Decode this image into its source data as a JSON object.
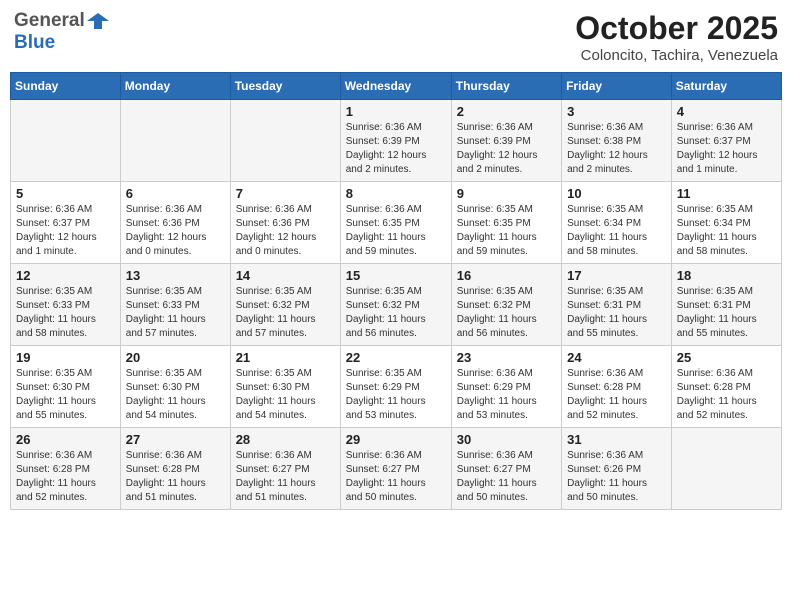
{
  "header": {
    "logo": {
      "general": "General",
      "blue": "Blue",
      "icon": "▶"
    },
    "title": "October 2025",
    "location": "Coloncito, Tachira, Venezuela"
  },
  "calendar": {
    "days_of_week": [
      "Sunday",
      "Monday",
      "Tuesday",
      "Wednesday",
      "Thursday",
      "Friday",
      "Saturday"
    ],
    "weeks": [
      [
        {
          "day": "",
          "info": ""
        },
        {
          "day": "",
          "info": ""
        },
        {
          "day": "",
          "info": ""
        },
        {
          "day": "1",
          "info": "Sunrise: 6:36 AM\nSunset: 6:39 PM\nDaylight: 12 hours\nand 2 minutes."
        },
        {
          "day": "2",
          "info": "Sunrise: 6:36 AM\nSunset: 6:39 PM\nDaylight: 12 hours\nand 2 minutes."
        },
        {
          "day": "3",
          "info": "Sunrise: 6:36 AM\nSunset: 6:38 PM\nDaylight: 12 hours\nand 2 minutes."
        },
        {
          "day": "4",
          "info": "Sunrise: 6:36 AM\nSunset: 6:37 PM\nDaylight: 12 hours\nand 1 minute."
        }
      ],
      [
        {
          "day": "5",
          "info": "Sunrise: 6:36 AM\nSunset: 6:37 PM\nDaylight: 12 hours\nand 1 minute."
        },
        {
          "day": "6",
          "info": "Sunrise: 6:36 AM\nSunset: 6:36 PM\nDaylight: 12 hours\nand 0 minutes."
        },
        {
          "day": "7",
          "info": "Sunrise: 6:36 AM\nSunset: 6:36 PM\nDaylight: 12 hours\nand 0 minutes."
        },
        {
          "day": "8",
          "info": "Sunrise: 6:36 AM\nSunset: 6:35 PM\nDaylight: 11 hours\nand 59 minutes."
        },
        {
          "day": "9",
          "info": "Sunrise: 6:35 AM\nSunset: 6:35 PM\nDaylight: 11 hours\nand 59 minutes."
        },
        {
          "day": "10",
          "info": "Sunrise: 6:35 AM\nSunset: 6:34 PM\nDaylight: 11 hours\nand 58 minutes."
        },
        {
          "day": "11",
          "info": "Sunrise: 6:35 AM\nSunset: 6:34 PM\nDaylight: 11 hours\nand 58 minutes."
        }
      ],
      [
        {
          "day": "12",
          "info": "Sunrise: 6:35 AM\nSunset: 6:33 PM\nDaylight: 11 hours\nand 58 minutes."
        },
        {
          "day": "13",
          "info": "Sunrise: 6:35 AM\nSunset: 6:33 PM\nDaylight: 11 hours\nand 57 minutes."
        },
        {
          "day": "14",
          "info": "Sunrise: 6:35 AM\nSunset: 6:32 PM\nDaylight: 11 hours\nand 57 minutes."
        },
        {
          "day": "15",
          "info": "Sunrise: 6:35 AM\nSunset: 6:32 PM\nDaylight: 11 hours\nand 56 minutes."
        },
        {
          "day": "16",
          "info": "Sunrise: 6:35 AM\nSunset: 6:32 PM\nDaylight: 11 hours\nand 56 minutes."
        },
        {
          "day": "17",
          "info": "Sunrise: 6:35 AM\nSunset: 6:31 PM\nDaylight: 11 hours\nand 55 minutes."
        },
        {
          "day": "18",
          "info": "Sunrise: 6:35 AM\nSunset: 6:31 PM\nDaylight: 11 hours\nand 55 minutes."
        }
      ],
      [
        {
          "day": "19",
          "info": "Sunrise: 6:35 AM\nSunset: 6:30 PM\nDaylight: 11 hours\nand 55 minutes."
        },
        {
          "day": "20",
          "info": "Sunrise: 6:35 AM\nSunset: 6:30 PM\nDaylight: 11 hours\nand 54 minutes."
        },
        {
          "day": "21",
          "info": "Sunrise: 6:35 AM\nSunset: 6:30 PM\nDaylight: 11 hours\nand 54 minutes."
        },
        {
          "day": "22",
          "info": "Sunrise: 6:35 AM\nSunset: 6:29 PM\nDaylight: 11 hours\nand 53 minutes."
        },
        {
          "day": "23",
          "info": "Sunrise: 6:36 AM\nSunset: 6:29 PM\nDaylight: 11 hours\nand 53 minutes."
        },
        {
          "day": "24",
          "info": "Sunrise: 6:36 AM\nSunset: 6:28 PM\nDaylight: 11 hours\nand 52 minutes."
        },
        {
          "day": "25",
          "info": "Sunrise: 6:36 AM\nSunset: 6:28 PM\nDaylight: 11 hours\nand 52 minutes."
        }
      ],
      [
        {
          "day": "26",
          "info": "Sunrise: 6:36 AM\nSunset: 6:28 PM\nDaylight: 11 hours\nand 52 minutes."
        },
        {
          "day": "27",
          "info": "Sunrise: 6:36 AM\nSunset: 6:28 PM\nDaylight: 11 hours\nand 51 minutes."
        },
        {
          "day": "28",
          "info": "Sunrise: 6:36 AM\nSunset: 6:27 PM\nDaylight: 11 hours\nand 51 minutes."
        },
        {
          "day": "29",
          "info": "Sunrise: 6:36 AM\nSunset: 6:27 PM\nDaylight: 11 hours\nand 50 minutes."
        },
        {
          "day": "30",
          "info": "Sunrise: 6:36 AM\nSunset: 6:27 PM\nDaylight: 11 hours\nand 50 minutes."
        },
        {
          "day": "31",
          "info": "Sunrise: 6:36 AM\nSunset: 6:26 PM\nDaylight: 11 hours\nand 50 minutes."
        },
        {
          "day": "",
          "info": ""
        }
      ]
    ]
  }
}
